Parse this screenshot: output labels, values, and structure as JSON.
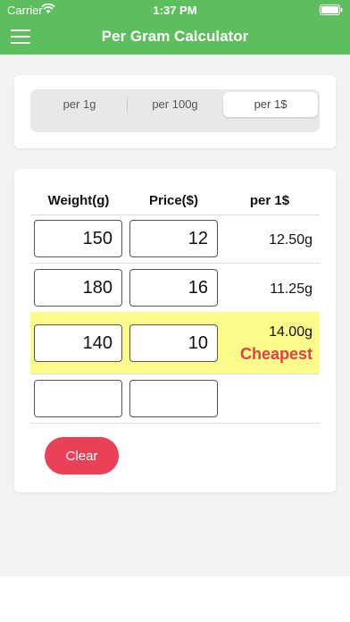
{
  "status": {
    "carrier": "Carrier",
    "time": "1:37 PM"
  },
  "nav": {
    "title": "Per Gram Calculator",
    "menu_icon": "hamburger-menu-icon"
  },
  "segments": {
    "items": [
      "per 1g",
      "per 100g",
      "per 1$"
    ],
    "selected": "per 1$"
  },
  "table": {
    "headers": {
      "weight": "Weight(g)",
      "price": "Price($)",
      "per": "per 1$"
    },
    "rows": [
      {
        "weight": "150",
        "price": "12",
        "result": "12.50g",
        "badge": ""
      },
      {
        "weight": "180",
        "price": "16",
        "result": "11.25g",
        "badge": ""
      },
      {
        "weight": "140",
        "price": "10",
        "result": "14.00g",
        "badge": "Cheapest",
        "highlighted": true
      },
      {
        "weight": "",
        "price": "",
        "result": "",
        "badge": ""
      }
    ]
  },
  "actions": {
    "clear": "Clear"
  },
  "colors": {
    "header": "#5cbe5c",
    "highlight": "#fbfb8c",
    "cheapest": "#e0404a",
    "clear_button": "#e84158"
  }
}
